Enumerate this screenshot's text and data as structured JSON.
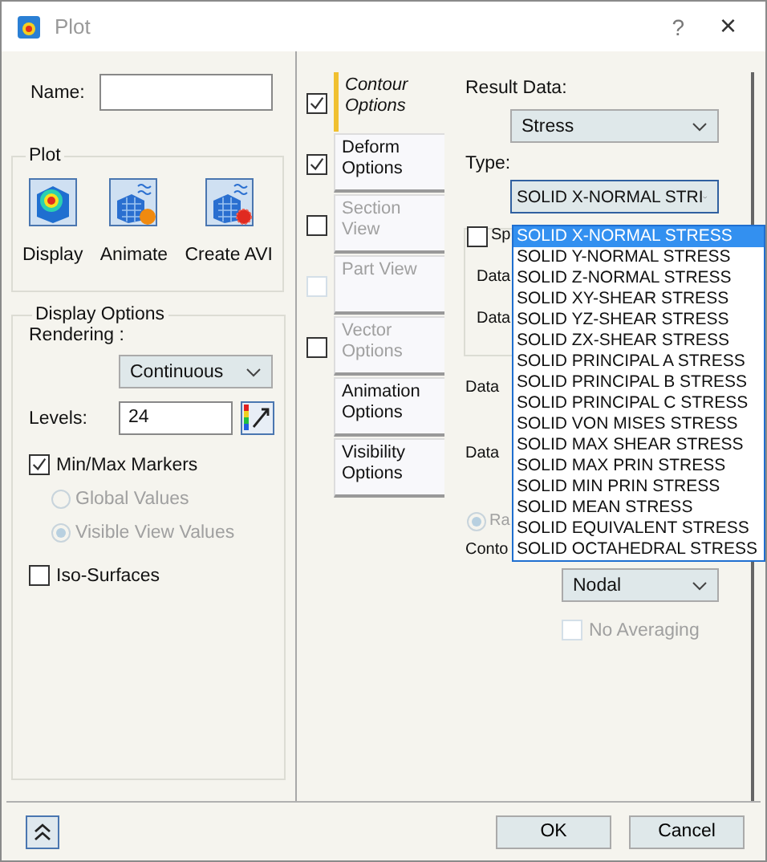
{
  "window": {
    "title": "Plot",
    "help": "?",
    "close": "×"
  },
  "name_field": {
    "label": "Name:"
  },
  "plot_group": {
    "title": "Plot",
    "actions": [
      {
        "label": "Display",
        "kind": "display"
      },
      {
        "label": "Animate",
        "kind": "animate"
      },
      {
        "label": "Create AVI",
        "kind": "avi"
      }
    ]
  },
  "display_options": {
    "title": "Display Options",
    "rendering": {
      "label": "Rendering :",
      "value": "Continuous"
    },
    "levels": {
      "label": "Levels:",
      "value": "24"
    },
    "min_max": {
      "label": "Min/Max Markers",
      "checked": true
    },
    "scope": [
      {
        "label": "Global Values",
        "selected": false,
        "disabled": true
      },
      {
        "label": "Visible View Values",
        "selected": true,
        "disabled": true
      }
    ],
    "iso_surfaces": {
      "label": "Iso-Surfaces",
      "checked": false
    }
  },
  "tabs": [
    {
      "label": "Contour Options",
      "kind": "check",
      "selected": true,
      "checked": true,
      "disabled": false,
      "check_disabled": false
    },
    {
      "label": "Deform Options",
      "kind": "check",
      "selected": false,
      "checked": true,
      "disabled": false,
      "check_disabled": false
    },
    {
      "label": "Section View",
      "kind": "check",
      "selected": false,
      "checked": false,
      "disabled": true,
      "check_disabled": false
    },
    {
      "label": "Part View",
      "kind": "check",
      "selected": false,
      "checked": false,
      "disabled": true,
      "check_disabled": true
    },
    {
      "label": "Vector Options",
      "kind": "check",
      "selected": false,
      "checked": false,
      "disabled": true,
      "check_disabled": false
    },
    {
      "label": "Animation Options",
      "kind": "plain",
      "selected": false,
      "disabled": false
    },
    {
      "label": "Visibility Options",
      "kind": "plain",
      "selected": false,
      "disabled": false
    }
  ],
  "contour": {
    "result_data": {
      "label": "Result Data:",
      "value": "Stress"
    },
    "type": {
      "label": "Type:",
      "value": "SOLID X-NORMAL STRI"
    },
    "type_list": [
      {
        "label": "SOLID X-NORMAL STRESS",
        "selected": true
      },
      {
        "label": "SOLID Y-NORMAL STRESS",
        "selected": false
      },
      {
        "label": "SOLID Z-NORMAL STRESS",
        "selected": false
      },
      {
        "label": "SOLID XY-SHEAR STRESS",
        "selected": false
      },
      {
        "label": "SOLID YZ-SHEAR STRESS",
        "selected": false
      },
      {
        "label": "SOLID ZX-SHEAR STRESS",
        "selected": false
      },
      {
        "label": "SOLID PRINCIPAL A STRESS",
        "selected": false
      },
      {
        "label": "SOLID PRINCIPAL B STRESS",
        "selected": false
      },
      {
        "label": "SOLID PRINCIPAL C STRESS",
        "selected": false
      },
      {
        "label": "SOLID VON MISES STRESS",
        "selected": false
      },
      {
        "label": "SOLID MAX SHEAR STRESS",
        "selected": false
      },
      {
        "label": "SOLID MAX PRIN STRESS",
        "selected": false
      },
      {
        "label": "SOLID MIN PRIN STRESS",
        "selected": false
      },
      {
        "label": "SOLID MEAN STRESS",
        "selected": false
      },
      {
        "label": "SOLID EQUIVALENT STRESS",
        "selected": false
      },
      {
        "label": "SOLID OCTAHEDRAL STRESS",
        "selected": false
      }
    ],
    "group_check": {
      "label": "Sp",
      "checked": false
    },
    "group_labels": [
      "Data",
      "Data"
    ],
    "data_c_label": "Data",
    "data_t_label": "Data",
    "radio": {
      "label": "Ra",
      "selected": true,
      "disabled": true
    },
    "contour_label": "Conto",
    "location": {
      "value": "Nodal"
    },
    "no_averaging": {
      "label": "No Averaging",
      "checked": false,
      "disabled": true
    }
  },
  "buttons": [
    "OK",
    "Cancel"
  ]
}
